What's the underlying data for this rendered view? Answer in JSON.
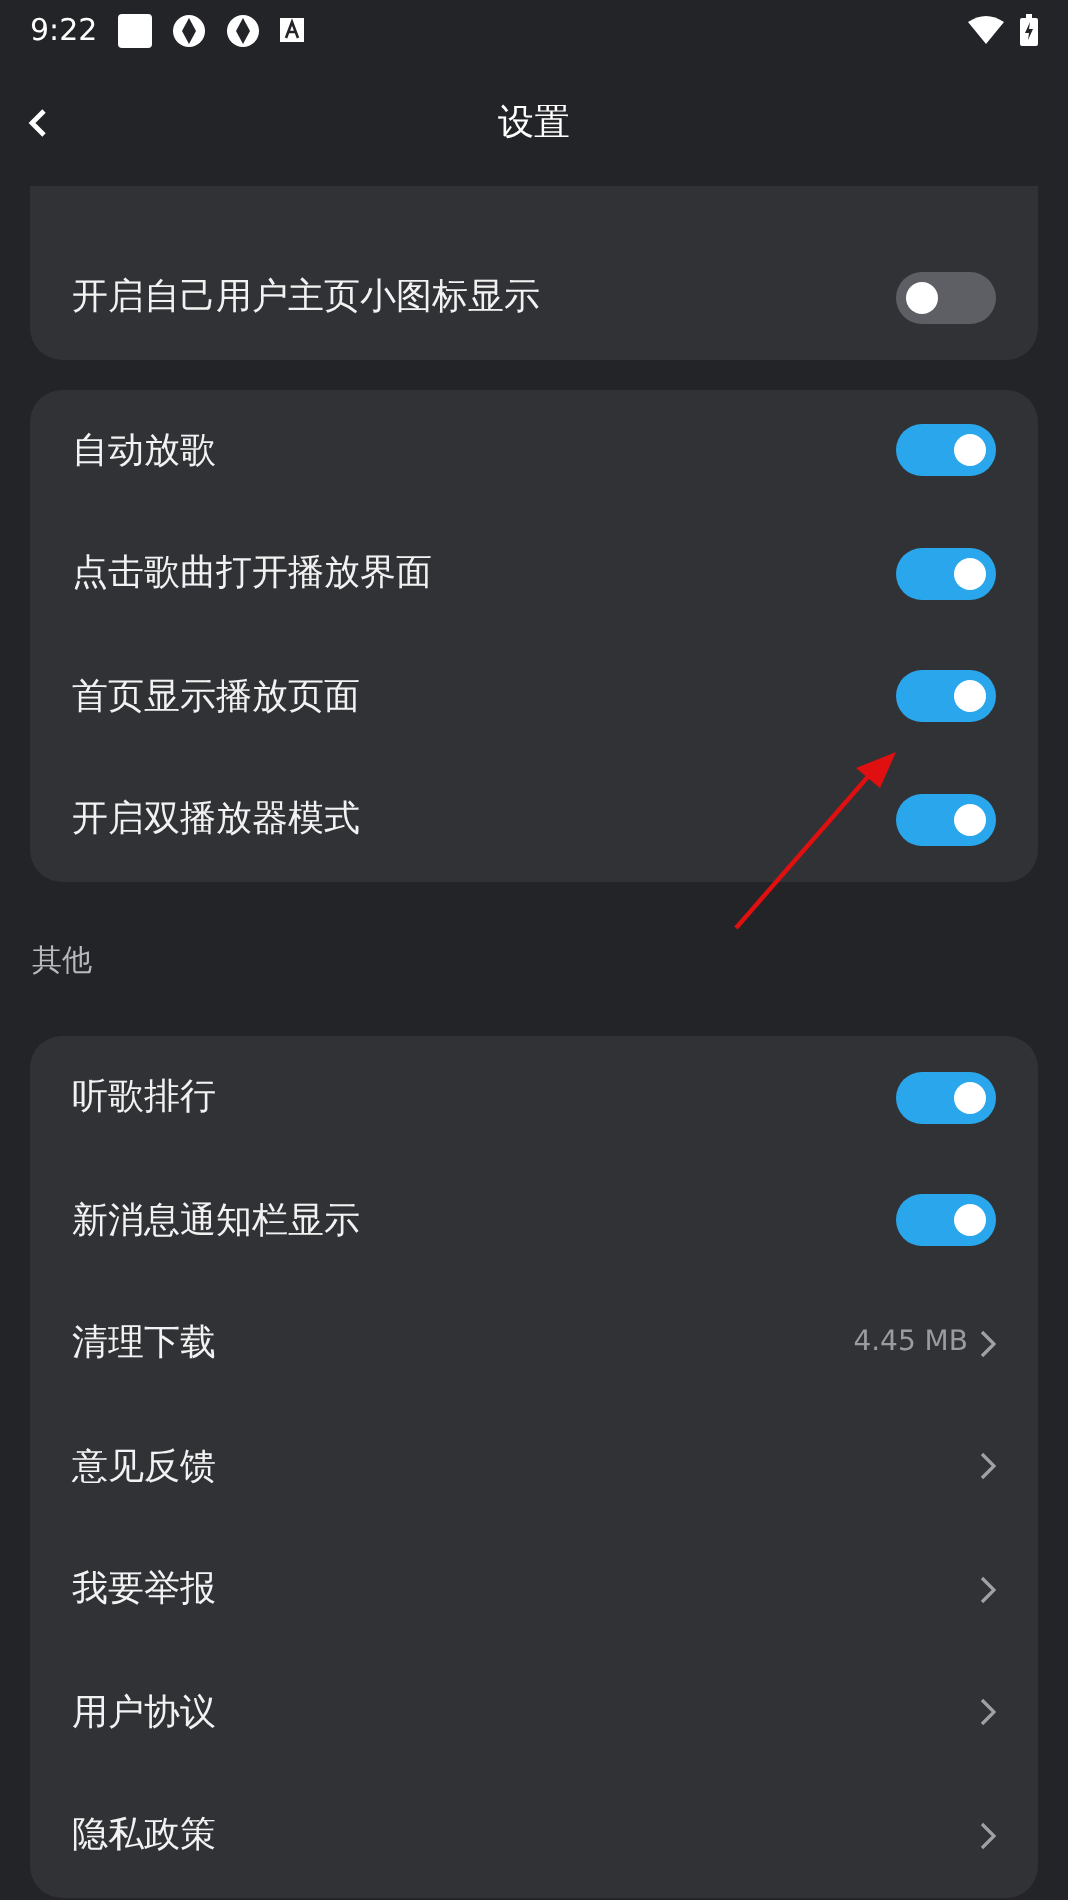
{
  "status_bar": {
    "time": "9:22"
  },
  "header": {
    "title": "设置"
  },
  "groups": [
    {
      "items": [
        {
          "kind": "toggle",
          "label": "开启自己用户主页小图标显示",
          "on": false
        }
      ]
    },
    {
      "items": [
        {
          "kind": "toggle",
          "label": "自动放歌",
          "on": true
        },
        {
          "kind": "toggle",
          "label": "点击歌曲打开播放界面",
          "on": true
        },
        {
          "kind": "toggle",
          "label": "首页显示播放页面",
          "on": true
        },
        {
          "kind": "toggle",
          "label": "开启双播放器模式",
          "on": true
        }
      ]
    },
    {
      "title": "其他",
      "items": [
        {
          "kind": "toggle",
          "label": "听歌排行",
          "on": true
        },
        {
          "kind": "toggle",
          "label": "新消息通知栏显示",
          "on": true
        },
        {
          "kind": "link",
          "label": "清理下载",
          "value": "4.45 MB"
        },
        {
          "kind": "link",
          "label": "意见反馈"
        },
        {
          "kind": "link",
          "label": "我要举报"
        },
        {
          "kind": "link",
          "label": "用户协议"
        },
        {
          "kind": "link",
          "label": "隐私政策"
        }
      ]
    }
  ]
}
